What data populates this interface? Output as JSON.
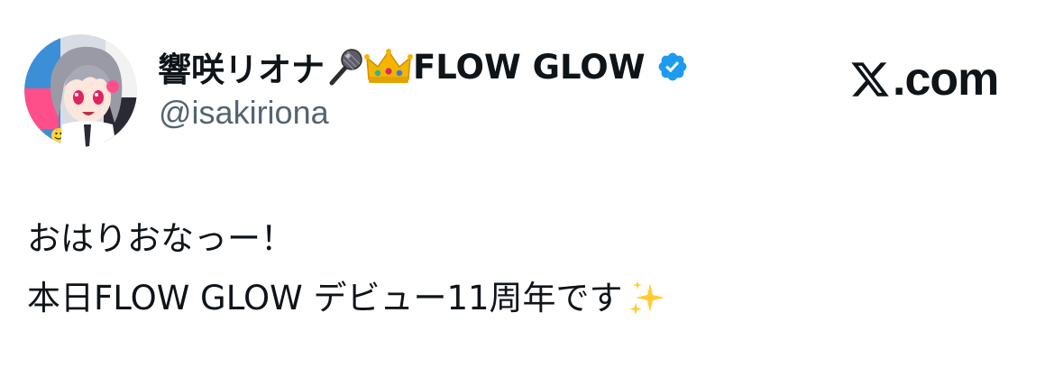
{
  "author": {
    "display_name": "響咲リオナ",
    "display_name_suffix": "FLOW GLOW",
    "name_emojis": [
      "microphone-emoji",
      "crown-emoji"
    ],
    "handle": "@isakiriona",
    "verified_color": "#1d9bf0"
  },
  "brand": {
    "logo_icon": "x-logo-icon",
    "suffix": ".com"
  },
  "tweet": {
    "line1": "おはりおなっー！",
    "line2": "本日FLOW GLOW デビュー11周年です",
    "line2_emoji": "sparkles-emoji"
  },
  "colors": {
    "text": "#0f1419",
    "secondary": "#536471",
    "accent": "#1d9bf0"
  }
}
